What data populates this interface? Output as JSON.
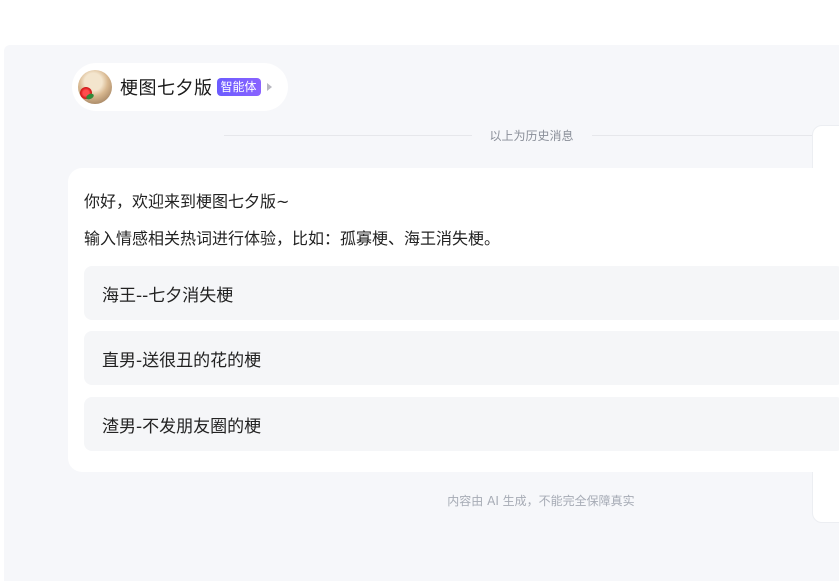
{
  "agent": {
    "name": "梗图七夕版",
    "badge": "智能体",
    "avatar_icon": "cat-with-rose-avatar",
    "chevron_icon": "chevron-right-icon"
  },
  "divider": {
    "label": "以上为历史消息"
  },
  "message": {
    "greeting": "你好，欢迎来到梗图七夕版~",
    "instruction": "输入情感相关热词进行体验，比如：孤寡梗、海王消失梗。",
    "suggestions": [
      {
        "label": "海王--七夕消失梗"
      },
      {
        "label": "直男-送很丑的花的梗"
      },
      {
        "label": "渣男-不发朋友圈的梗"
      }
    ]
  },
  "footer": {
    "disclaimer": "内容由 AI 生成，不能完全保障真实"
  },
  "colors": {
    "page_background": "#f6f7fa",
    "card_background": "#ffffff",
    "badge_gradient_start": "#6b5cff",
    "badge_gradient_end": "#8a63ff",
    "suggestion_background": "#f5f6f8"
  }
}
